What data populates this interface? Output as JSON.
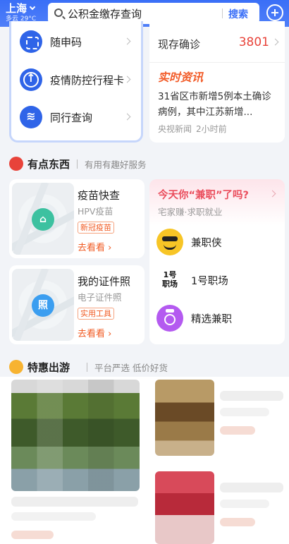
{
  "header": {
    "city": "上海",
    "weather": "多云 29°C",
    "search_value": "公积金缴存查询",
    "search_button": "搜索"
  },
  "left_services": [
    {
      "label": "随申码",
      "icon": "qr-code-icon"
    },
    {
      "label": "疫情防控行程卡",
      "icon": "arrow-up-circle-icon"
    },
    {
      "label": "同行查询",
      "icon": "boat-icon"
    }
  ],
  "stats": {
    "label": "现存确诊",
    "value": "3801"
  },
  "news": {
    "tag": "实时资讯",
    "text": "31省区市新增5例本土确诊病例，其中江苏新增...",
    "source": "央视新闻",
    "time": "2小时前"
  },
  "section_fun": {
    "title": "有点东西",
    "subtitle": "有用有趣好服务"
  },
  "service_cards": [
    {
      "title": "疫苗快查",
      "subtitle": "HPV疫苗",
      "tag": "新冠疫苗",
      "link": "去看看",
      "badge": ""
    },
    {
      "title": "我的证件照",
      "subtitle": "电子证件照",
      "tag": "实用工具",
      "link": "去看看",
      "badge": "照"
    }
  ],
  "jobs": {
    "title": "今天你“兼职”了吗?",
    "subtitle": "宅家赚·求职就业",
    "items": [
      {
        "name": "兼职侠",
        "icon": "smiley-mask-icon"
      },
      {
        "name": "1号职场",
        "icon": "job-logo-icon",
        "logo_text": "1号",
        "logo_text2": "职场"
      },
      {
        "name": "精选兼职",
        "icon": "medal-icon"
      }
    ]
  },
  "section_travel": {
    "title": "特惠出游",
    "subtitle": "平台严选 低价好货"
  },
  "colors": {
    "header_blue": "#3a6ff7",
    "alert_red": "#e8433a",
    "accent_orange": "#f05a22"
  }
}
